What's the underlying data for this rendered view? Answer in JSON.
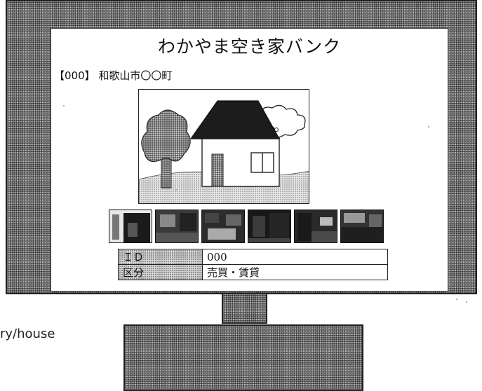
{
  "site": {
    "title": "わかやま空き家バンク"
  },
  "listing": {
    "title": "【000】 和歌山市〇〇町",
    "main_photo": {
      "subject": "house-illustration"
    },
    "thumbnails": [
      {
        "subject": "entrance-photo"
      },
      {
        "subject": "living-room-photo"
      },
      {
        "subject": "bedroom-photo"
      },
      {
        "subject": "dark-room-photo"
      },
      {
        "subject": "hallway-photo"
      },
      {
        "subject": "kitchen-photo"
      }
    ],
    "info": [
      {
        "label": "ＩＤ",
        "value": "000"
      },
      {
        "label": "区分",
        "value": "売買・賃貸"
      }
    ]
  },
  "caption": "ry/house",
  "colors": {
    "frame": "#8a8a8a",
    "outline": "#222222",
    "screen": "#ffffff"
  }
}
